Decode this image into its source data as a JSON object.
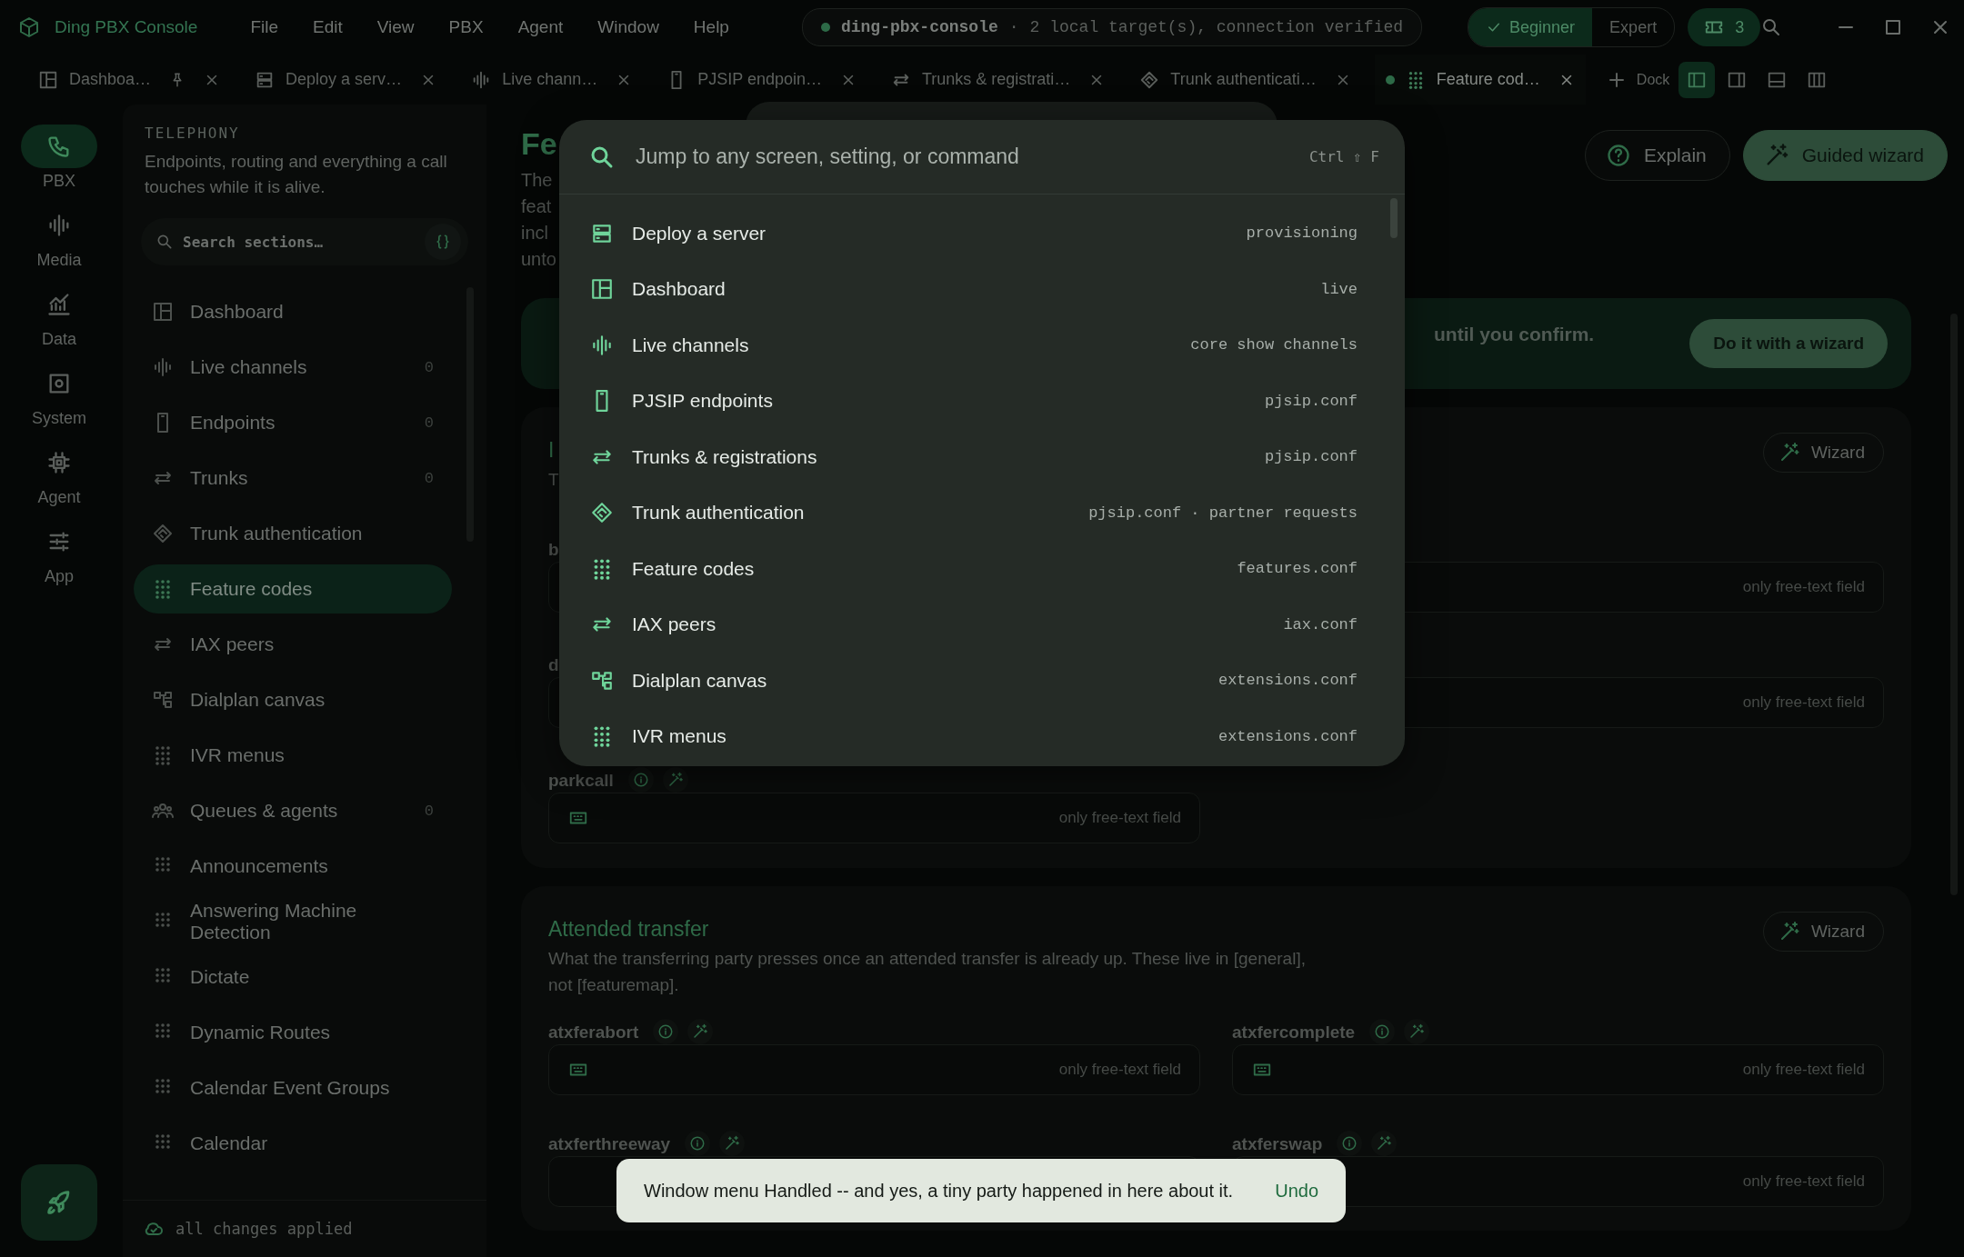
{
  "app": {
    "title": "Ding PBX Console",
    "menu": [
      "File",
      "Edit",
      "View",
      "PBX",
      "Agent",
      "Window",
      "Help"
    ],
    "connection": {
      "target": "ding-pbx-console",
      "separator": "·",
      "status": "2 local target(s), connection verified"
    },
    "modes": [
      {
        "label": "Beginner",
        "selected": true
      },
      {
        "label": "Expert",
        "selected": false
      }
    ],
    "badge": "3"
  },
  "tabs": [
    {
      "label": "Dashboa…",
      "kind": "dashboard",
      "pinned": true,
      "selected": false
    },
    {
      "label": "Deploy a serv…",
      "kind": "server",
      "pinned": false,
      "selected": false
    },
    {
      "label": "Live chann…",
      "kind": "waveform",
      "pinned": false,
      "selected": false
    },
    {
      "label": "PJSIP endpoin…",
      "kind": "mobile",
      "pinned": false,
      "selected": false
    },
    {
      "label": "Trunks & registrati…",
      "kind": "swap",
      "pinned": false,
      "selected": false
    },
    {
      "label": "Trunk authenticati…",
      "kind": "diamond",
      "pinned": false,
      "selected": false
    },
    {
      "label": "Feature cod…",
      "kind": "dialpad",
      "pinned": false,
      "selected": true
    }
  ],
  "dock": {
    "label": "Dock",
    "layouts": [
      {
        "kind": "left",
        "selected": true
      },
      {
        "kind": "right",
        "selected": false
      },
      {
        "kind": "bottom",
        "selected": false
      },
      {
        "kind": "columns",
        "selected": false
      }
    ]
  },
  "rail": [
    {
      "label": "PBX",
      "kind": "phone",
      "selected": true
    },
    {
      "label": "Media",
      "kind": "waveform",
      "selected": false
    },
    {
      "label": "Data",
      "kind": "chart",
      "selected": false
    },
    {
      "label": "System",
      "kind": "settings",
      "selected": false
    },
    {
      "label": "Agent",
      "kind": "chip",
      "selected": false
    },
    {
      "label": "App",
      "kind": "sliders",
      "selected": false
    }
  ],
  "sidebar": {
    "heading": "TELEPHONY",
    "description": "Endpoints, routing and everything a call touches while it is alive.",
    "search": {
      "placeholder": "Search sections…"
    },
    "items": [
      {
        "label": "Dashboard",
        "kind": "dashboard",
        "selected": false
      },
      {
        "label": "Live channels",
        "kind": "waveform",
        "count": "0",
        "selected": false
      },
      {
        "label": "Endpoints",
        "kind": "mobile",
        "count": "0",
        "selected": false
      },
      {
        "label": "Trunks",
        "kind": "swap",
        "count": "0",
        "selected": false
      },
      {
        "label": "Trunk authentication",
        "kind": "diamond",
        "selected": false
      },
      {
        "label": "Feature codes",
        "kind": "dialpad",
        "selected": true
      },
      {
        "label": "IAX peers",
        "kind": "swap",
        "selected": false
      },
      {
        "label": "Dialplan canvas",
        "kind": "flow",
        "selected": false
      },
      {
        "label": "IVR menus",
        "kind": "dialpad",
        "selected": false
      },
      {
        "label": "Queues & agents",
        "kind": "group",
        "count": "0",
        "selected": false
      },
      {
        "label": "Announcements",
        "kind": "grid",
        "selected": false
      },
      {
        "label": "Answering Machine Detection",
        "kind": "grid",
        "selected": false
      },
      {
        "label": "Dictate",
        "kind": "grid",
        "selected": false
      },
      {
        "label": "Dynamic Routes",
        "kind": "grid",
        "selected": false
      },
      {
        "label": "Calendar Event Groups",
        "kind": "grid",
        "selected": false
      },
      {
        "label": "Calendar",
        "kind": "grid",
        "selected": false
      }
    ],
    "footer": "all changes applied"
  },
  "page": {
    "title": "Fe",
    "description": [
      "The",
      "feat",
      "incl",
      "unto"
    ],
    "actions": [
      {
        "label": "Explain",
        "kind": "help"
      },
      {
        "label": "Guided wizard",
        "kind": "wand"
      }
    ],
    "banner": {
      "text": "until you confirm.",
      "action": "Do it with a wizard"
    },
    "sections": [
      {
        "title": "I",
        "description": [
          "T"
        ],
        "action": "Wizard",
        "fields": [
          {
            "label": "b",
            "tools": false,
            "keyboard": false
          },
          {
            "placeholder": "only free-text field",
            "keyboard": false
          },
          {
            "label": "d",
            "tools": false,
            "keyboard": false
          },
          {
            "placeholder": "only free-text field",
            "keyboard": false
          },
          {
            "label": "parkcall",
            "placeholder": "only free-text field",
            "keyboard": true
          }
        ]
      },
      {
        "title": "Attended transfer",
        "description": [
          "What the transferring party presses once an attended transfer is already up. These live in [general],",
          "not [featuremap]."
        ],
        "action": "Wizard",
        "fields": [
          {
            "label": "atxferabort",
            "placeholder": "only free-text field",
            "keyboard": true
          },
          {
            "label": "atxfercomplete",
            "placeholder": "only free-text field",
            "keyboard": true
          },
          {
            "label": "atxferthreeway",
            "keyboard": false
          },
          {
            "label": "atxferswap",
            "placeholder": "only free-text field",
            "keyboard": false
          }
        ]
      }
    ]
  },
  "palette": {
    "placeholder": "Jump to any screen, setting, or command",
    "shortcut": "Ctrl ⇧ F",
    "items": [
      {
        "label": "Deploy a server",
        "kind": "server",
        "hint": "provisioning"
      },
      {
        "label": "Dashboard",
        "kind": "dashboard",
        "hint": "live"
      },
      {
        "label": "Live channels",
        "kind": "waveform",
        "hint": "core show channels"
      },
      {
        "label": "PJSIP endpoints",
        "kind": "mobile",
        "hint": "pjsip.conf"
      },
      {
        "label": "Trunks & registrations",
        "kind": "swap",
        "hint": "pjsip.conf"
      },
      {
        "label": "Trunk authentication",
        "kind": "diamond",
        "hint": "pjsip.conf · partner requests"
      },
      {
        "label": "Feature codes",
        "kind": "dialpad",
        "hint": "features.conf"
      },
      {
        "label": "IAX peers",
        "kind": "swap",
        "hint": "iax.conf"
      },
      {
        "label": "Dialplan canvas",
        "kind": "flow",
        "hint": "extensions.conf"
      },
      {
        "label": "IVR menus",
        "kind": "dialpad",
        "hint": "extensions.conf"
      }
    ]
  },
  "toast": {
    "message": "Window menu Handled -- and yes, a tiny party happened in here about it.",
    "action": "Undo"
  }
}
